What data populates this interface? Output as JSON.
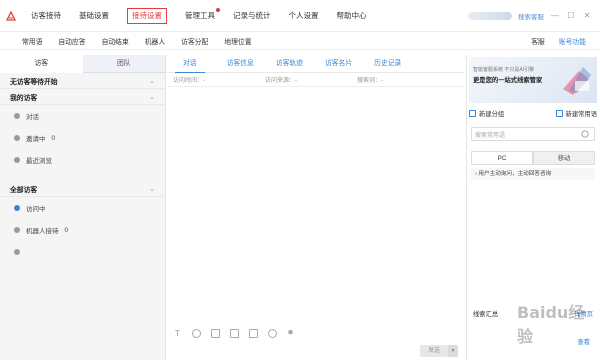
{
  "nav": {
    "items": [
      "访客接待",
      "基础设置",
      "接待设置",
      "管理工具",
      "记录与统计",
      "个人设置",
      "帮助中心"
    ],
    "active_index": 2,
    "user_link": "搜索客服"
  },
  "subnav": {
    "items": [
      "常用语",
      "自动应答",
      "自动结束",
      "机器人",
      "访客分配",
      "地理位置"
    ],
    "right_label": "客服",
    "right_link": "账号功能"
  },
  "left": {
    "tabs": [
      "访客",
      "团队"
    ],
    "section1": {
      "title": "无访客等待开始"
    },
    "section2": {
      "title": "我的访客",
      "rows": [
        {
          "label": "对话",
          "count": ""
        },
        {
          "label": "邀请中",
          "count": "0"
        },
        {
          "label": "最近浏览",
          "count": ""
        }
      ]
    },
    "section3": {
      "title": "全部访客",
      "rows": [
        {
          "label": "访问中",
          "count": ""
        },
        {
          "label": "机器人接待",
          "count": "0"
        },
        {
          "label": "",
          "count": ""
        }
      ]
    }
  },
  "center": {
    "tabs": [
      "对话",
      "访客信息",
      "访客轨迹",
      "访客名片",
      "历史记录"
    ],
    "fields": [
      "访问时间：-",
      "访问来源：-",
      "搜索词：-"
    ],
    "send_label": "发送",
    "send_drop": "▾"
  },
  "right": {
    "banner_small": "智能客服系统 不只是AI引擎",
    "banner_big": "更是您的一站式线索管家",
    "btn_new_group": "新建分组",
    "btn_new_phrase": "新建常用语",
    "search_placeholder": "搜索常用语",
    "tabs": [
      "PC",
      "移动"
    ],
    "phrase": "用户主动询问，主动回答咨询",
    "footer_label": "线索汇总",
    "footer_link": "详情页",
    "footer2": "查看"
  },
  "watermark": "Baidu经验",
  "colors": {
    "accent": "#3a86d6",
    "active_red": "#e33c3c"
  },
  "icons": {
    "logo": "agent-logo-icon",
    "minimize": "minimize-icon",
    "maximize": "maximize-icon",
    "close": "close-icon"
  }
}
